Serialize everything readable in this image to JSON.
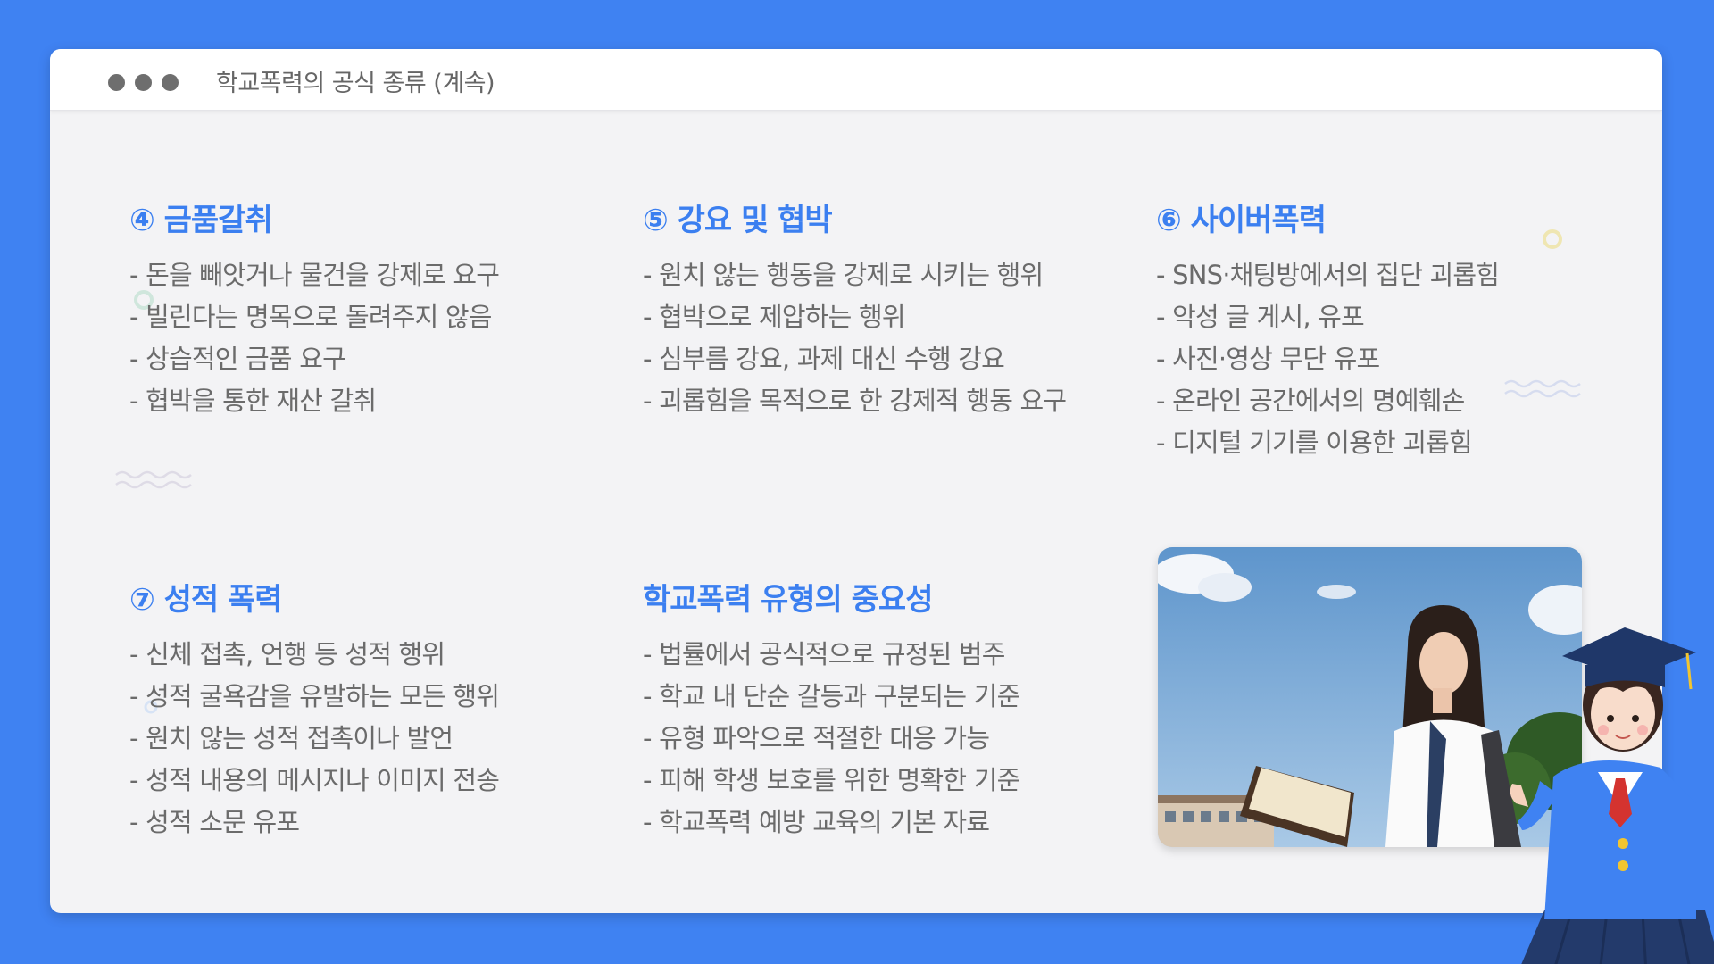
{
  "window": {
    "title": "학교폭력의 공식 종류 (계속)"
  },
  "sections": [
    {
      "heading": "④ 금품갈취",
      "items": [
        "- 돈을 빼앗거나 물건을 강제로 요구",
        "- 빌린다는 명목으로 돌려주지 않음",
        "- 상습적인 금품 요구",
        "- 협박을 통한 재산 갈취"
      ]
    },
    {
      "heading": "⑤ 강요 및 협박",
      "items": [
        "- 원치 않는 행동을 강제로 시키는 행위",
        "- 협박으로 제압하는 행위",
        "- 심부름 강요, 과제 대신 수행 강요",
        "- 괴롭힘을 목적으로 한 강제적 행동 요구"
      ]
    },
    {
      "heading": "⑥ 사이버폭력",
      "items": [
        "- SNS·채팅방에서의 집단 괴롭힘",
        "- 악성 글 게시, 유포",
        "- 사진·영상 무단 유포",
        "- 온라인 공간에서의 명예훼손",
        "- 디지털 기기를 이용한 괴롭힘"
      ]
    },
    {
      "heading": "⑦ 성적 폭력",
      "items": [
        "- 신체 접촉, 언행 등 성적 행위",
        "- 성적 굴욕감을 유발하는 모든 행위",
        "- 원치 않는 성적 접촉이나 발언",
        "- 성적 내용의 메시지나 이미지 전송",
        "- 성적 소문 유포"
      ]
    },
    {
      "heading": "학교폭력 유형의 중요성",
      "items": [
        "- 법률에서 공식적으로 규정된 범주",
        "- 학교 내 단순 갈등과 구분되는 기준",
        "- 유형 파악으로 적절한 대응 가능",
        "- 피해 학생 보호를 위한 명확한 기준",
        "- 학교폭력 예방 교육의 기본 자료"
      ]
    }
  ],
  "colors": {
    "background": "#3f82f2",
    "accent": "#3b7ff0",
    "body_text": "#6b6b6b"
  }
}
